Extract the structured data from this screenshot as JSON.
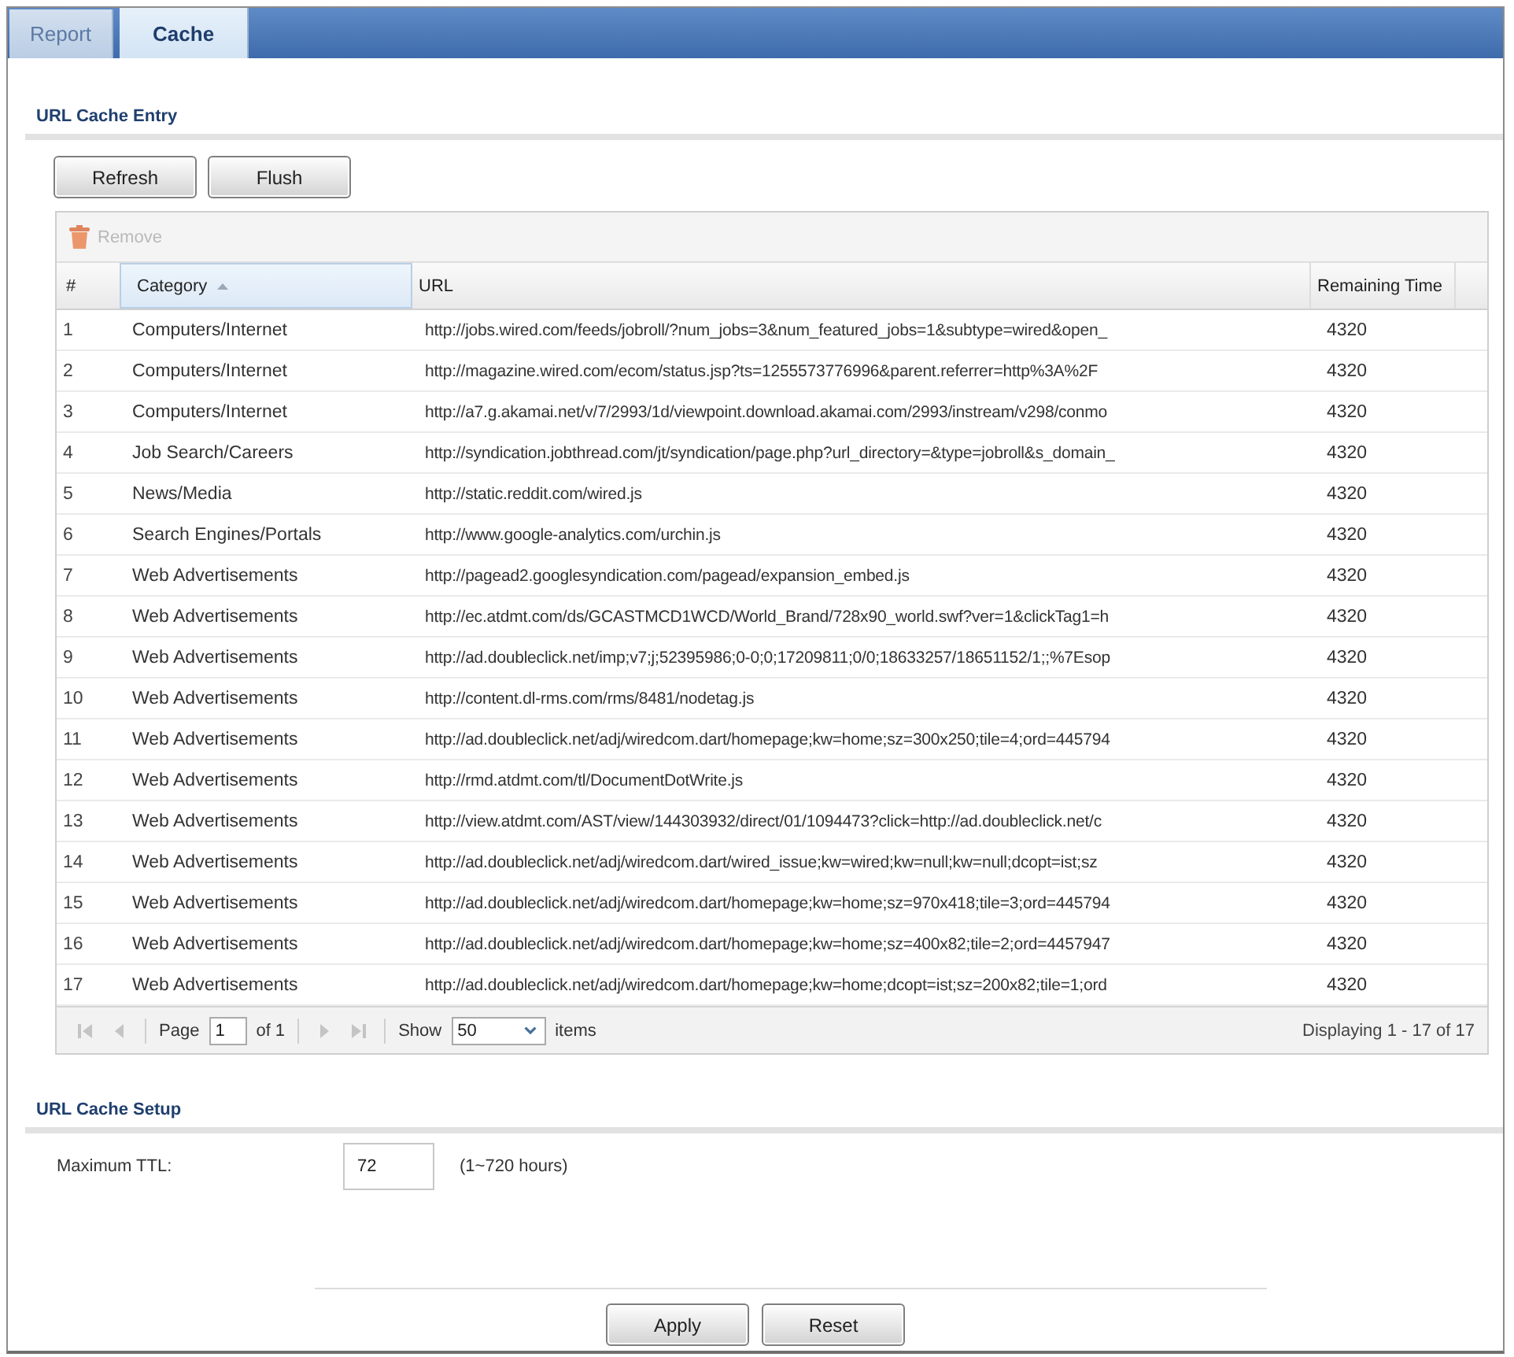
{
  "tabs": [
    {
      "label": "Report",
      "selected": false
    },
    {
      "label": "Cache",
      "selected": true
    }
  ],
  "entry_section": {
    "title": "URL Cache Entry",
    "buttons": [
      "Refresh",
      "Flush"
    ],
    "remove": {
      "label": "Remove",
      "disabled": true
    },
    "table": {
      "columns": [
        {
          "label": "#",
          "sorted": false
        },
        {
          "label": "Category",
          "sorted": true
        },
        {
          "label": "URL",
          "sorted": false
        },
        {
          "label": "Remaining Time",
          "sorted": false
        }
      ],
      "rows": [
        {
          "number": "1",
          "category": "Computers/Internet",
          "url": "http://jobs.wired.com/feeds/jobroll/?num_jobs=3&num_featured_jobs=1&subtype=wired&open_",
          "remaining_time": "4320"
        },
        {
          "number": "2",
          "category": "Computers/Internet",
          "url": "http://magazine.wired.com/ecom/status.jsp?ts=1255573776996&parent.referrer=http%3A%2F",
          "remaining_time": "4320"
        },
        {
          "number": "3",
          "category": "Computers/Internet",
          "url": "http://a7.g.akamai.net/v/7/2993/1d/viewpoint.download.akamai.com/2993/instream/v298/conmo",
          "remaining_time": "4320"
        },
        {
          "number": "4",
          "category": "Job Search/Careers",
          "url": "http://syndication.jobthread.com/jt/syndication/page.php?url_directory=&type=jobroll&s_domain_",
          "remaining_time": "4320"
        },
        {
          "number": "5",
          "category": "News/Media",
          "url": "http://static.reddit.com/wired.js",
          "remaining_time": "4320"
        },
        {
          "number": "6",
          "category": "Search Engines/Portals",
          "url": "http://www.google-analytics.com/urchin.js",
          "remaining_time": "4320"
        },
        {
          "number": "7",
          "category": "Web Advertisements",
          "url": "http://pagead2.googlesyndication.com/pagead/expansion_embed.js",
          "remaining_time": "4320"
        },
        {
          "number": "8",
          "category": "Web Advertisements",
          "url": "http://ec.atdmt.com/ds/GCASTMCD1WCD/World_Brand/728x90_world.swf?ver=1&clickTag1=h",
          "remaining_time": "4320"
        },
        {
          "number": "9",
          "category": "Web Advertisements",
          "url": "http://ad.doubleclick.net/imp;v7;j;52395986;0-0;0;17209811;0/0;18633257/18651152/1;;%7Esop",
          "remaining_time": "4320"
        },
        {
          "number": "10",
          "category": "Web Advertisements",
          "url": "http://content.dl-rms.com/rms/8481/nodetag.js",
          "remaining_time": "4320"
        },
        {
          "number": "11",
          "category": "Web Advertisements",
          "url": "http://ad.doubleclick.net/adj/wiredcom.dart/homepage;kw=home;sz=300x250;tile=4;ord=445794",
          "remaining_time": "4320"
        },
        {
          "number": "12",
          "category": "Web Advertisements",
          "url": "http://rmd.atdmt.com/tl/DocumentDotWrite.js",
          "remaining_time": "4320"
        },
        {
          "number": "13",
          "category": "Web Advertisements",
          "url": "http://view.atdmt.com/AST/view/144303932/direct/01/1094473?click=http://ad.doubleclick.net/c",
          "remaining_time": "4320"
        },
        {
          "number": "14",
          "category": "Web Advertisements",
          "url": "http://ad.doubleclick.net/adj/wiredcom.dart/wired_issue;kw=wired;kw=null;kw=null;dcopt=ist;sz",
          "remaining_time": "4320"
        },
        {
          "number": "15",
          "category": "Web Advertisements",
          "url": "http://ad.doubleclick.net/adj/wiredcom.dart/homepage;kw=home;sz=970x418;tile=3;ord=445794",
          "remaining_time": "4320"
        },
        {
          "number": "16",
          "category": "Web Advertisements",
          "url": "http://ad.doubleclick.net/adj/wiredcom.dart/homepage;kw=home;sz=400x82;tile=2;ord=4457947",
          "remaining_time": "4320"
        },
        {
          "number": "17",
          "category": "Web Advertisements",
          "url": "http://ad.doubleclick.net/adj/wiredcom.dart/homepage;kw=home;dcopt=ist;sz=200x82;tile=1;ord",
          "remaining_time": "4320"
        }
      ]
    },
    "pager": {
      "nav_back": [
        {
          "kind": "first",
          "disabled": true
        },
        {
          "kind": "prev",
          "disabled": true
        }
      ],
      "page_label": "Page",
      "page": "1",
      "page_count": "of 1",
      "nav_forward": [
        {
          "kind": "next",
          "disabled": true
        },
        {
          "kind": "last",
          "disabled": true
        }
      ],
      "show_label": "Show",
      "per_page": "50",
      "items_label": "items",
      "summary": "Displaying 1 - 17 of 17"
    }
  },
  "setup_section": {
    "title": "URL Cache Setup",
    "fields": [
      {
        "label": "Maximum TTL:",
        "value": "72",
        "hint": "(1~720 hours)"
      }
    ]
  },
  "actions": [
    "Apply",
    "Reset"
  ]
}
